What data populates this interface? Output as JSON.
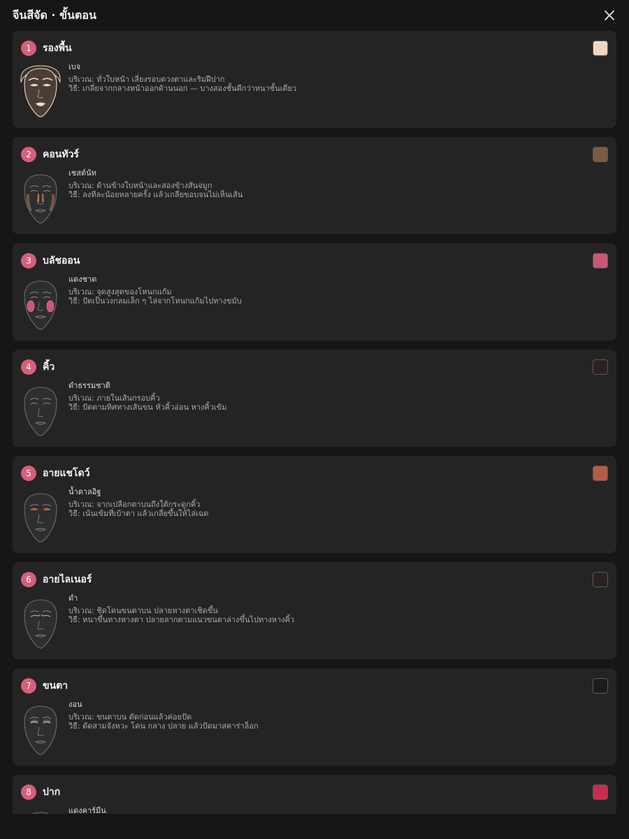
{
  "header": {
    "title": "จีนสีจัด · ขั้นตอน"
  },
  "icons": {
    "close": "close-icon",
    "face": "face-outline-icon"
  },
  "steps": [
    {
      "num": "1",
      "title": "รองพื้น",
      "shade": "เบจ",
      "color": "#f1d7c2",
      "area": "บริเวณ: ทั่วใบหน้า เลี่ยงรอบดวงตาและริมฝีปาก",
      "method": "วิธี: เกลี่ยจากกลางหน้าออกด้านนอก — บางสองชั้นดีกว่าหนาชั้นเดียว"
    },
    {
      "num": "2",
      "title": "คอนทัวร์",
      "shade": "เชสต์นัท",
      "color": "#7b5a46",
      "area": "บริเวณ: ด้านข้างใบหน้าและสองข้างสันจมูก",
      "method": "วิธี: ลงทีละน้อยหลายครั้ง แล้วเกลี่ยขอบจนไม่เห็นเส้น"
    },
    {
      "num": "3",
      "title": "บลัชออน",
      "shade": "แดงชาด",
      "color": "#cc5775",
      "area": "บริเวณ: จุดสูงสุดของโหนกแก้ม",
      "method": "วิธี: ปัดเป็นวงกลมเล็ก ๆ ไล่จากโหนกแก้มไปทางขมับ"
    },
    {
      "num": "4",
      "title": "คิ้ว",
      "shade": "ดำธรรมชาติ",
      "color": "#2b2220",
      "area": "บริเวณ: ภายในเส้นกรอบคิ้ว",
      "method": "วิธี: ปัดตามทิศทางเส้นขน หัวคิ้วอ่อน หางคิ้วเข้ม"
    },
    {
      "num": "5",
      "title": "อายแชโดว์",
      "shade": "น้ำตาลอิฐ",
      "color": "#b35d45",
      "area": "บริเวณ: จากเปลือกตาบนถึงใต้กระดูกคิ้ว",
      "method": "วิธี: เน้นเข้มที่เบ้าตา แล้วเกลี่ยขึ้นให้ไล่เฉด"
    },
    {
      "num": "6",
      "title": "อายไลเนอร์",
      "shade": "ดำ",
      "color": "#2a2120",
      "area": "บริเวณ: ชิดโคนขนตาบน ปลายหางตาเชิดขึ้น",
      "method": "วิธี: หนาขึ้นทางหางตา ปลายลากตามแนวขนตาล่างขึ้นไปทางหางคิ้ว"
    },
    {
      "num": "7",
      "title": "ขนตา",
      "shade": "งอน",
      "color": "#1d1a1a",
      "area": "บริเวณ: ขนตาบน ดัดก่อนแล้วค่อยปัด",
      "method": "วิธี: ดัดสามจังหวะ โคน กลาง ปลาย แล้วปัดมาสคาร่าล็อก"
    },
    {
      "num": "8",
      "title": "ปาก",
      "shade": "แดงคาร์มีน",
      "color": "#c42e4e",
      "area": "",
      "method": ""
    }
  ]
}
